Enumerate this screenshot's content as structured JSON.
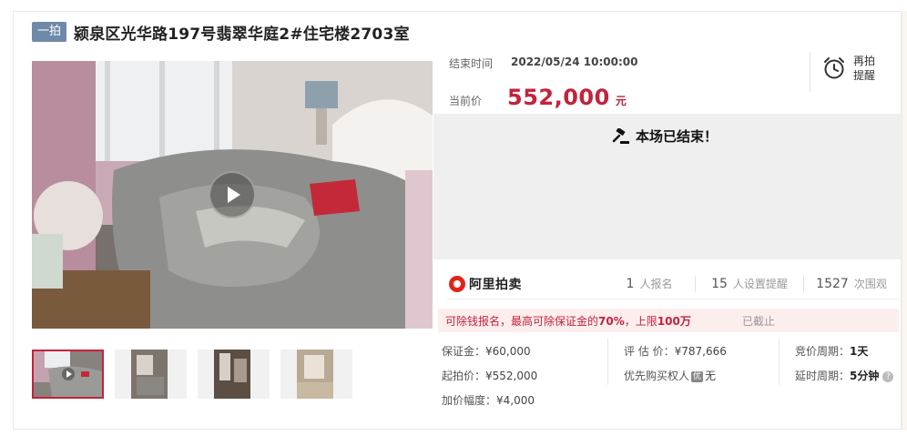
{
  "listing": {
    "badge": "一拍",
    "title": "颍泉区光华路197号翡翠华庭2#住宅楼2703室"
  },
  "auction": {
    "end_label": "结束时间",
    "end_time": "2022/05/24 10:00:00",
    "price_label": "当前价",
    "current_price": "552,000",
    "price_unit": "元",
    "remind_label": "再拍提醒",
    "ended_message": "本场已结束！"
  },
  "platform": {
    "name": "阿里拍卖"
  },
  "stats": [
    {
      "num": "1",
      "label": "人报名"
    },
    {
      "num": "15",
      "label": "人设置提醒"
    },
    {
      "num": "1527",
      "label": "次围观"
    }
  ],
  "deposit_bar": {
    "prefix": "可除钱报名，最高可除保证金的",
    "percent": "70%",
    "mid": "，上限",
    "cap": "100万",
    "status": "已截止"
  },
  "details": {
    "deposit": {
      "k": "保证金：",
      "v": "¥60,000"
    },
    "start_price": {
      "k": "起拍价：",
      "v": "¥552,000"
    },
    "increment": {
      "k": "加价幅度：",
      "v": "¥4,000"
    },
    "appraisal": {
      "k": "评 估 价：",
      "v": "¥787,666"
    },
    "priority": {
      "k": "优先购买权人",
      "tag": "优",
      "v": "无"
    },
    "bid_cycle": {
      "k": "竞价周期：",
      "v": "1天"
    },
    "extend_cycle": {
      "k": "延时周期：",
      "v": "5分钟"
    }
  },
  "media": {
    "main_play_icon": "play-icon",
    "thumbnails": [
      "thumbnail-1",
      "thumbnail-2",
      "thumbnail-3",
      "thumbnail-4"
    ]
  },
  "colors": {
    "accent": "#c2233b",
    "badge": "#6f8aa8",
    "ended_bg": "#efefef"
  }
}
